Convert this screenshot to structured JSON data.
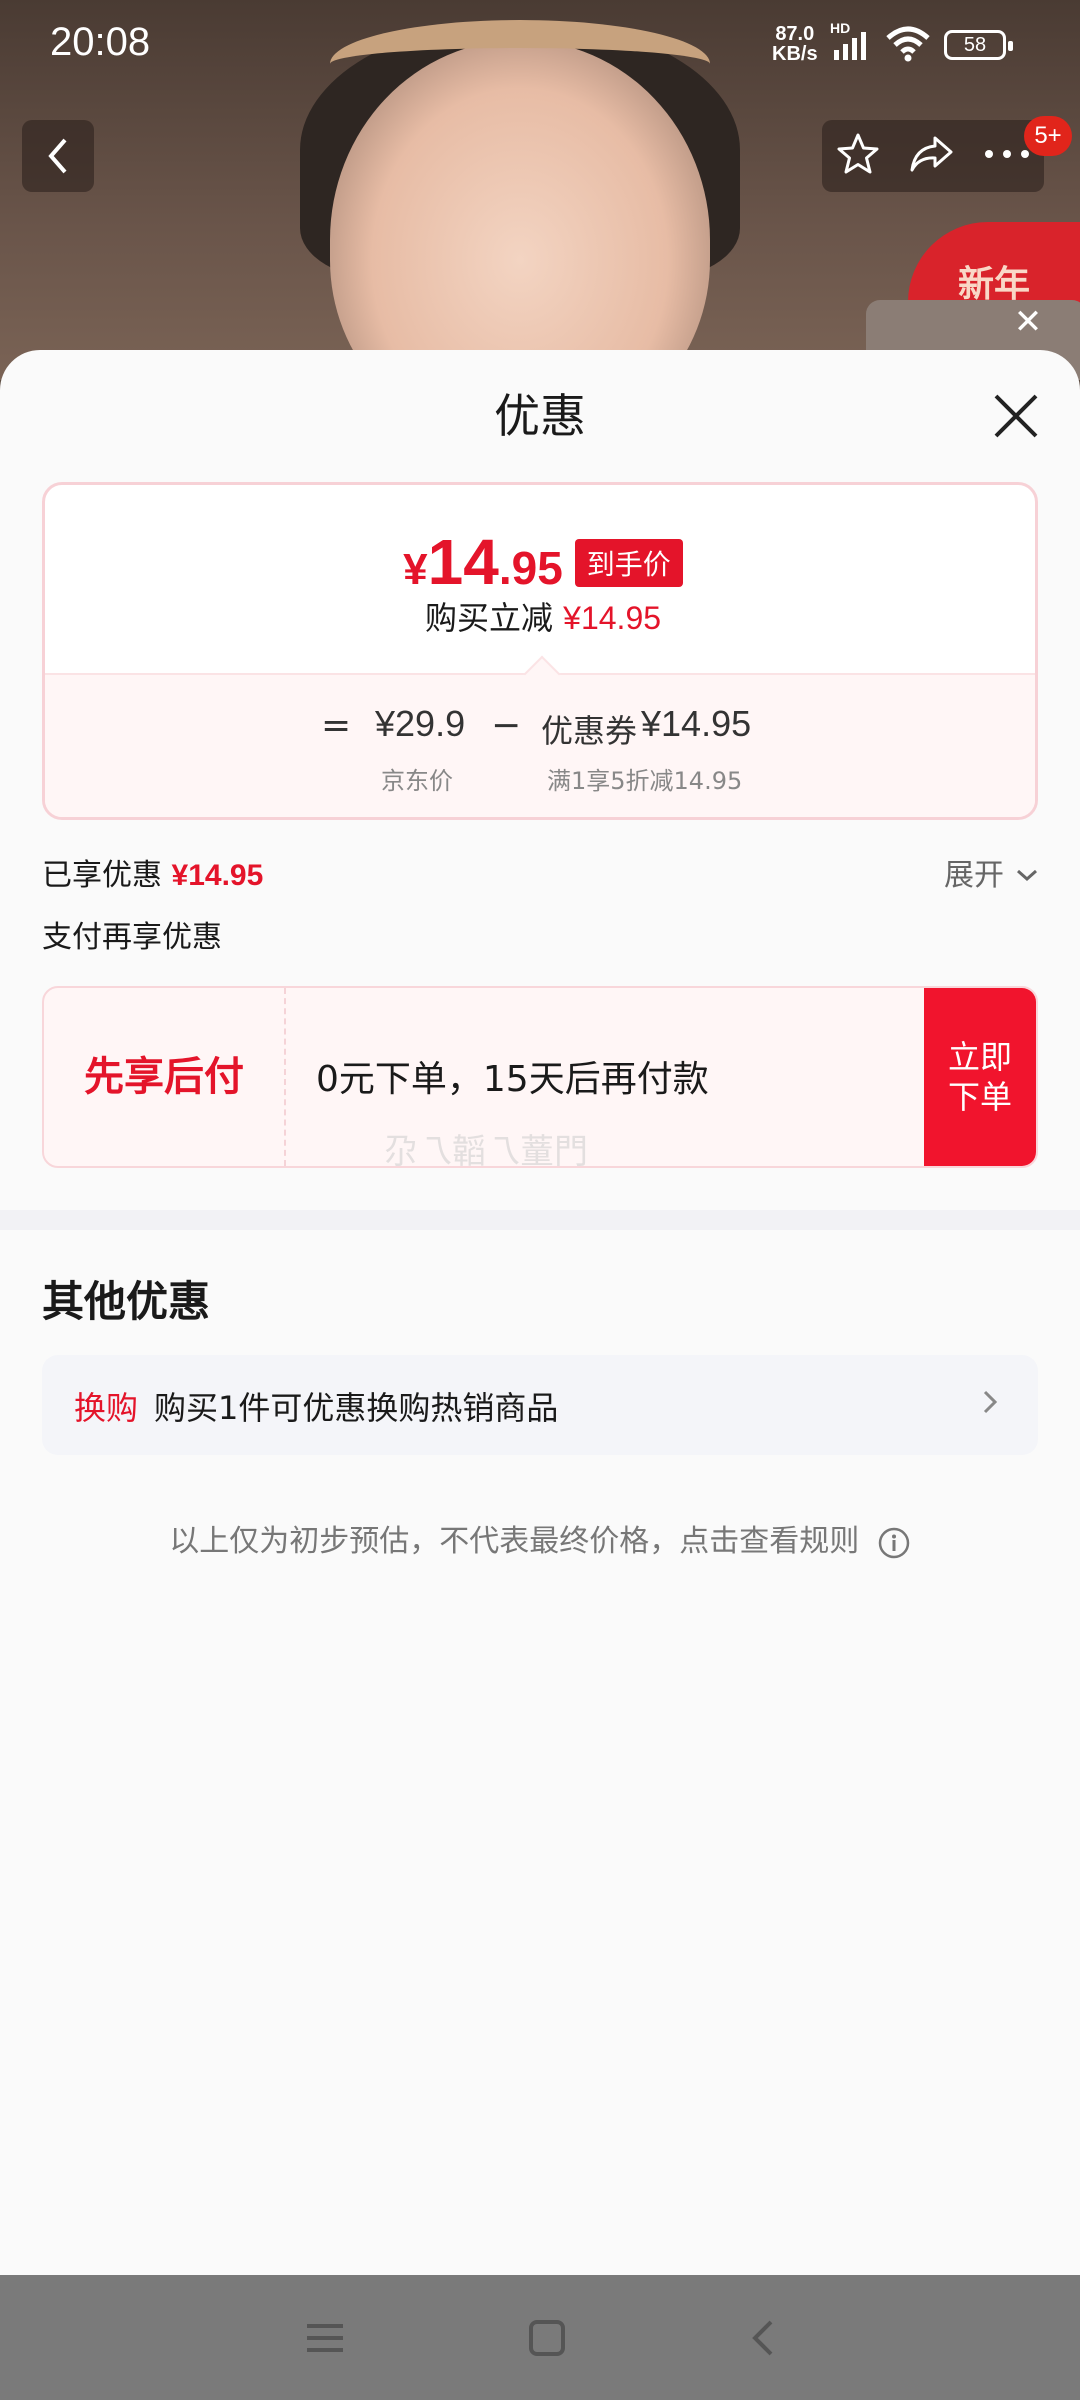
{
  "status_bar": {
    "time": "20:08",
    "net_speed_value": "87.0",
    "net_speed_unit": "KB/s",
    "hd_label": "HD",
    "battery": "58"
  },
  "product_header": {
    "cart_badge": "5+",
    "promo_text": "新年"
  },
  "sheet": {
    "title": "优惠",
    "price_card": {
      "currency": "¥",
      "price_int": "14",
      "price_dec": ".95",
      "price_tag": "到手价",
      "save_label": "购买立减",
      "save_value": "¥14.95",
      "breakdown": {
        "equals": "=",
        "base_price": "¥29.9",
        "base_label": "京东价",
        "minus": "−",
        "coupon_name": "优惠券",
        "coupon_value": "¥14.95",
        "coupon_label": "满1享5折减14.95"
      }
    },
    "enjoyed": {
      "label": "已享优惠",
      "value": "¥14.95",
      "expand_label": "展开"
    },
    "pay_section": {
      "title": "支付再享优惠",
      "bnpl_name": "先享后付",
      "bnpl_desc": "0元下单，15天后再付款",
      "bnpl_btn_line1": "立即",
      "bnpl_btn_line2": "下单",
      "watermark": "尕乁韜乁蕫門"
    },
    "other": {
      "title": "其他优惠",
      "exchange_tag": "换购",
      "exchange_text": "购买1件可优惠换购热销商品"
    },
    "disclaimer": "以上仅为初步预估，不代表最终价格，点击查看规则"
  },
  "colors": {
    "accent_red": "#e4142a",
    "card_border": "#f7d1d6",
    "sheet_bg": "#fafafa"
  },
  "icons": [
    "back-icon",
    "star-icon",
    "share-icon",
    "more-icon",
    "close-icon",
    "chevron-down-icon",
    "chevron-right-icon",
    "info-icon",
    "menu-icon",
    "home-icon",
    "nav-back-icon"
  ]
}
